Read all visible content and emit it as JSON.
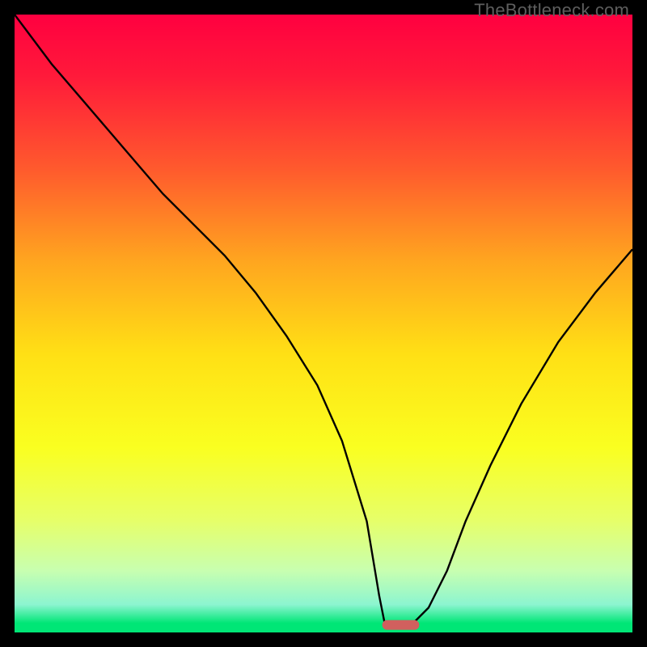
{
  "watermark": "TheBottleneck.com",
  "chart_data": {
    "type": "line",
    "title": "",
    "xlabel": "",
    "ylabel": "",
    "xlim": [
      0,
      100
    ],
    "ylim": [
      0,
      100
    ],
    "grid": false,
    "background": {
      "type": "vertical-gradient",
      "stops": [
        {
          "pos": 0.0,
          "color": "#ff0040"
        },
        {
          "pos": 0.1,
          "color": "#ff1a3a"
        },
        {
          "pos": 0.25,
          "color": "#ff5a2d"
        },
        {
          "pos": 0.4,
          "color": "#ffa61f"
        },
        {
          "pos": 0.55,
          "color": "#ffe015"
        },
        {
          "pos": 0.7,
          "color": "#faff20"
        },
        {
          "pos": 0.82,
          "color": "#e6ff6a"
        },
        {
          "pos": 0.9,
          "color": "#c8ffb0"
        },
        {
          "pos": 0.955,
          "color": "#8cf5d0"
        },
        {
          "pos": 0.985,
          "color": "#00e676"
        },
        {
          "pos": 1.0,
          "color": "#00e676"
        }
      ]
    },
    "series": [
      {
        "name": "bottleneck-curve",
        "color": "#000000",
        "x": [
          0,
          6,
          12,
          18,
          24,
          29,
          34,
          39,
          44,
          49,
          53,
          57,
          59,
          60,
          61,
          64,
          67,
          70,
          73,
          77,
          82,
          88,
          94,
          100
        ],
        "y": [
          100,
          92,
          85,
          78,
          71,
          66,
          61,
          55,
          48,
          40,
          31,
          18,
          6,
          1,
          1,
          1,
          4,
          10,
          18,
          27,
          37,
          47,
          55,
          62
        ]
      }
    ],
    "marker": {
      "name": "optimal-zone",
      "shape": "rounded-bar",
      "color": "#d1605e",
      "x_range": [
        59.5,
        65.5
      ],
      "y": 1.2
    }
  }
}
